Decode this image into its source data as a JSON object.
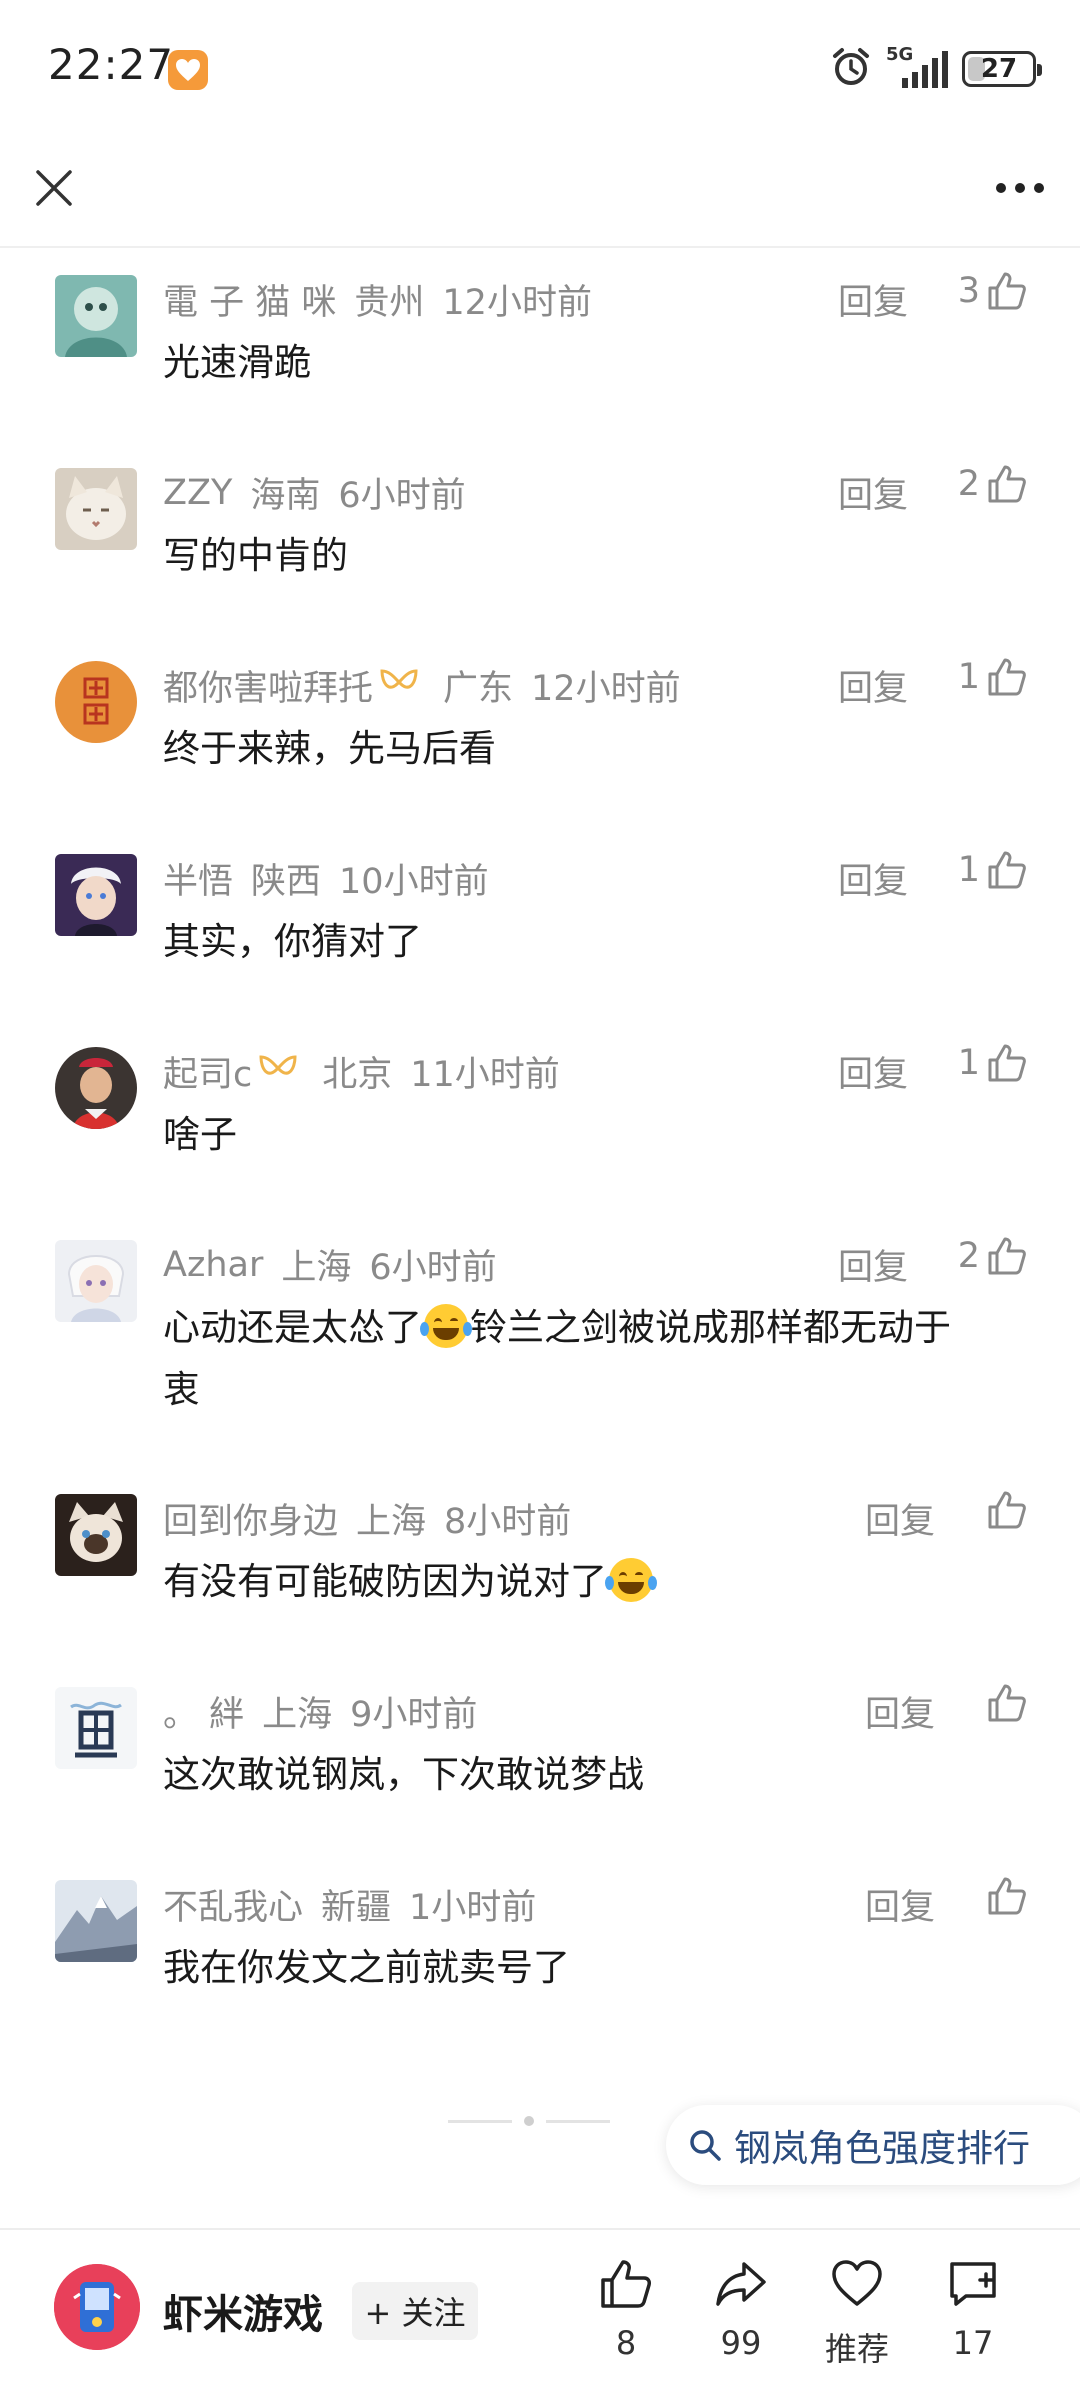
{
  "status_bar": {
    "time": "22:27",
    "network": "5G",
    "battery": "27",
    "battery_level": 0.27
  },
  "comments": [
    {
      "user": "電 子 猫 咪",
      "vip": false,
      "region": "贵州",
      "time": "12小时前",
      "reply": "回复",
      "likes": "3",
      "text": "光速滑跪"
    },
    {
      "user": "ZZY",
      "vip": false,
      "region": "海南",
      "time": "6小时前",
      "reply": "回复",
      "likes": "2",
      "text": "写的中肯的"
    },
    {
      "user": "都你害啦拜托",
      "vip": true,
      "region": "广东",
      "time": "12小时前",
      "reply": "回复",
      "likes": "1",
      "text": "终于来辣，先马后看"
    },
    {
      "user": "半悟",
      "vip": false,
      "region": "陕西",
      "time": "10小时前",
      "reply": "回复",
      "likes": "1",
      "text": "其实，你猜对了"
    },
    {
      "user": "起司c",
      "vip": true,
      "region": "北京",
      "time": "11小时前",
      "reply": "回复",
      "likes": "1",
      "text": "啥子"
    },
    {
      "user": "Azhar",
      "vip": false,
      "region": "上海",
      "time": "6小时前",
      "reply": "回复",
      "likes": "2",
      "text_a": "心动还是太怂了",
      "text_b": "铃兰之剑被说成那样都无动于",
      "text_c": "衷"
    },
    {
      "user": "回到你身边",
      "vip": false,
      "region": "上海",
      "time": "8小时前",
      "reply": "回复",
      "likes": "",
      "text_a": "有没有可能破防因为说对了"
    },
    {
      "user": "。 絆",
      "vip": false,
      "region": "上海",
      "time": "9小时前",
      "reply": "回复",
      "likes": "",
      "text": "这次敢说钢岚，下次敢说梦战"
    },
    {
      "user": "不乱我心",
      "vip": false,
      "region": "新疆",
      "time": "1小时前",
      "reply": "回复",
      "likes": "",
      "text": "我在你发文之前就卖号了"
    }
  ],
  "search_chip": {
    "text": "钢岚角色强度排行"
  },
  "bottom_bar": {
    "account_name": "虾米游戏",
    "follow_label": "+ 关注",
    "like_count": "8",
    "share_count": "99",
    "recommend_label": "推荐",
    "comment_count": "17"
  },
  "colors": {
    "accent_link": "#2b4c7e",
    "meta_gray": "#8a8a8a",
    "avatar_orange": "#e8913a",
    "account_red": "#e8405a"
  }
}
